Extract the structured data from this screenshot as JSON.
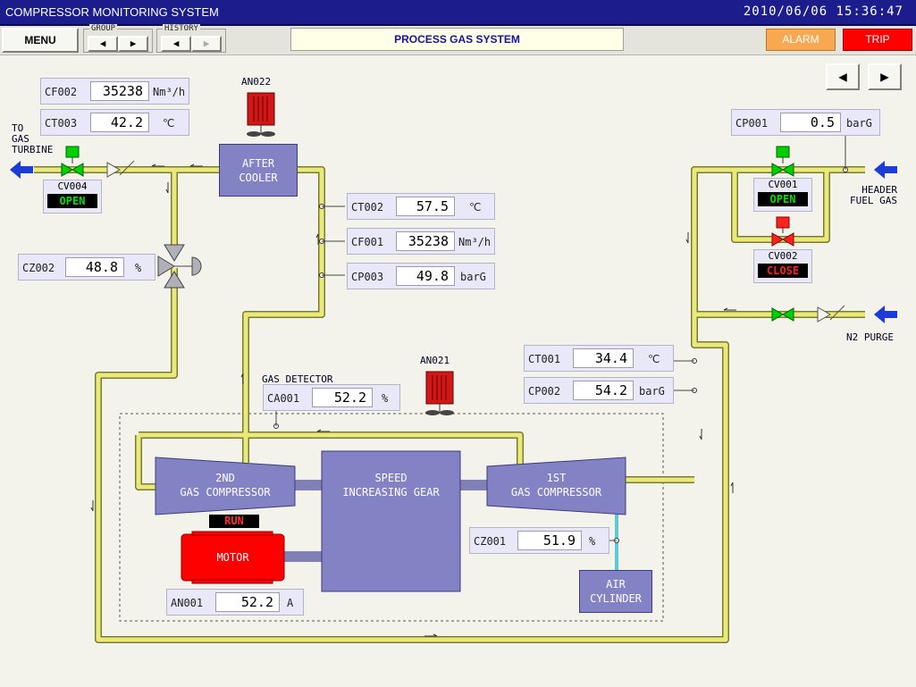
{
  "header": {
    "title": "COMPRESSOR MONITORING SYSTEM",
    "datetime": "2010/06/06 15:36:47"
  },
  "toolbar": {
    "menu_label": "MENU",
    "group_label": "GROUP",
    "history_label": "HISTORY",
    "screen_title": "PROCESS GAS SYSTEM",
    "alarm_label": "ALARM",
    "trip_label": "TRIP"
  },
  "colors": {
    "title_bar": "#1c1c8c",
    "pipe": "#e8e878",
    "equipment": "#8282c4",
    "motor": "#ff0000",
    "alarm": "#f8a850",
    "trip": "#ff0000",
    "valve_open": "#00d000",
    "valve_closed": "#ff0000"
  },
  "icons": {
    "prev": "prev-arrow-icon",
    "next": "next-arrow-icon",
    "fan": "fan-icon",
    "flow_arrow": "blue-flow-arrow-icon"
  },
  "instruments": {
    "cf002": {
      "tag": "CF002",
      "value": "35238",
      "unit": "Nm³/h"
    },
    "ct003": {
      "tag": "CT003",
      "value": "42.2",
      "unit": "℃"
    },
    "ct002": {
      "tag": "CT002",
      "value": "57.5",
      "unit": "℃"
    },
    "cf001": {
      "tag": "CF001",
      "value": "35238",
      "unit": "Nm³/h"
    },
    "cp003": {
      "tag": "CP003",
      "value": "49.8",
      "unit": "barG"
    },
    "cz002": {
      "tag": "CZ002",
      "value": "48.8",
      "unit": "%"
    },
    "cp001": {
      "tag": "CP001",
      "value": "0.5",
      "unit": "barG"
    },
    "ct001": {
      "tag": "CT001",
      "value": "34.4",
      "unit": "℃"
    },
    "cp002": {
      "tag": "CP002",
      "value": "54.2",
      "unit": "barG"
    },
    "ca001": {
      "tag": "CA001",
      "value": "52.2",
      "unit": "%"
    },
    "cz001": {
      "tag": "CZ001",
      "value": "51.9",
      "unit": "%"
    },
    "an001": {
      "tag": "AN001",
      "value": "52.2",
      "unit": "A"
    }
  },
  "valves": {
    "cv004": {
      "tag": "CV004",
      "status": "OPEN"
    },
    "cv001": {
      "tag": "CV001",
      "status": "OPEN"
    },
    "cv002": {
      "tag": "CV002",
      "status": "CLOSE"
    }
  },
  "fans": {
    "an022": "AN022",
    "an021": "AN021"
  },
  "equipment": {
    "after_cooler": [
      "AFTER",
      "COOLER"
    ],
    "second_compressor": [
      "2ND",
      "GAS COMPRESSOR"
    ],
    "gear": [
      "SPEED",
      "INCREASING GEAR"
    ],
    "first_compressor": [
      "1ST",
      "GAS COMPRESSOR"
    ],
    "motor": "MOTOR",
    "motor_status": "RUN",
    "air_cylinder": [
      "AIR",
      "CYLINDER"
    ]
  },
  "labels": {
    "to_gas_turbine": [
      "TO",
      "GAS",
      "TURBINE"
    ],
    "header_fuel_gas": [
      "HEADER",
      "FUEL GAS"
    ],
    "n2_purge": "N2 PURGE",
    "gas_detector": "GAS DETECTOR"
  }
}
